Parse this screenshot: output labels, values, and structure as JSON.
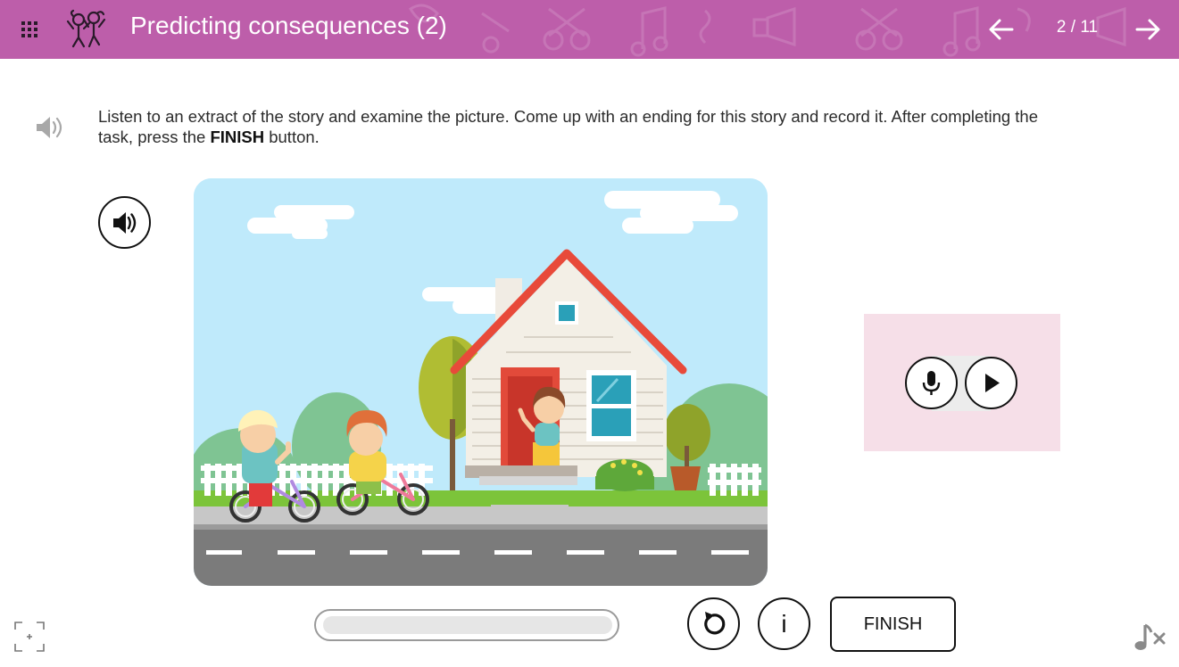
{
  "header": {
    "title": "Predicting consequences (2)",
    "page_counter": "2 / 11",
    "background_color": "#bd5eaa",
    "menu_icon": "grid-menu-icon",
    "logo_icon": "dancing-kids-logo-icon",
    "prev_icon": "arrow-left-icon",
    "next_icon": "arrow-right-icon"
  },
  "instruction": {
    "audio_icon": "speaker-icon",
    "text_part1": "Listen to an extract of the story and examine the picture. Come up with an ending for this story and record it. After completing the task, press the ",
    "text_bold": "FINISH",
    "text_part2": " button."
  },
  "story": {
    "audio_icon": "speaker-icon",
    "picture": "house-kids-bikes-illustration"
  },
  "recorder": {
    "panel_color": "#f6dfe8",
    "record_icon": "microphone-icon",
    "play_icon": "play-icon"
  },
  "controls": {
    "progress": 0,
    "reset_icon": "reset-icon",
    "info_label": "i",
    "finish_label": "FINISH",
    "fullscreen_icon": "fullscreen-icon",
    "music_icon": "music-off-icon"
  }
}
